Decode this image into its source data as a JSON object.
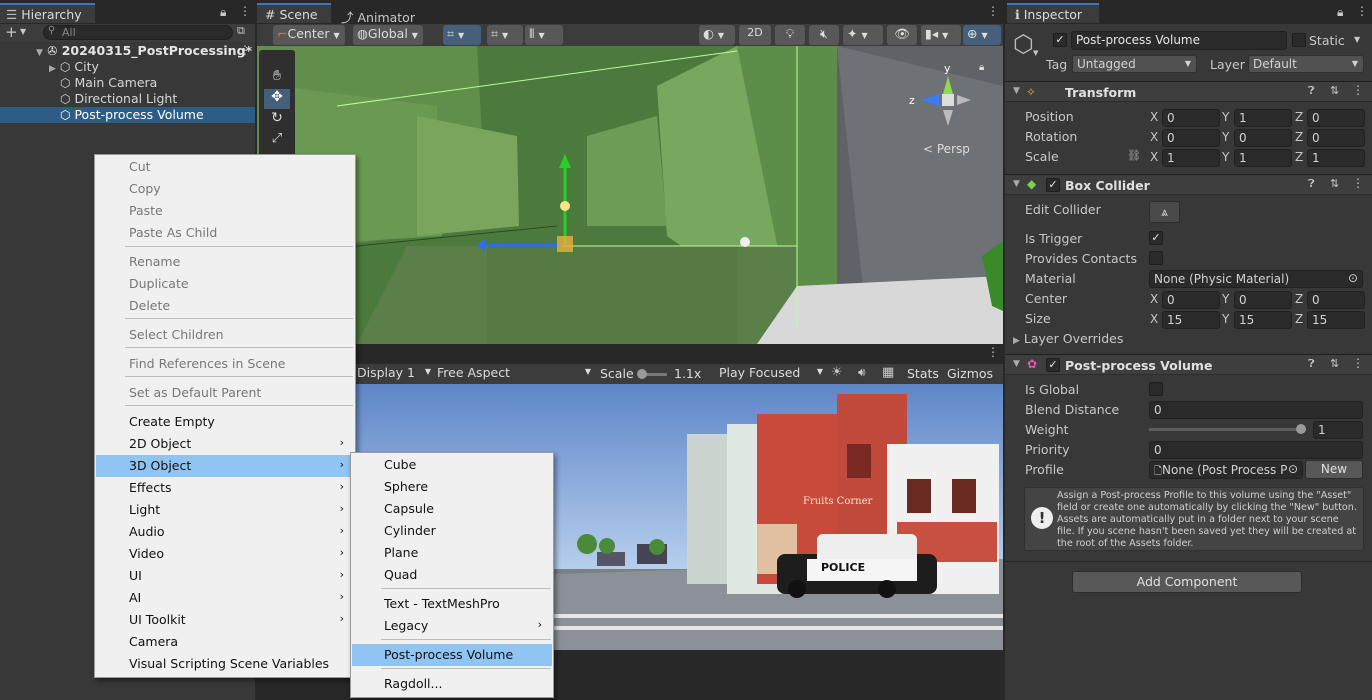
{
  "hierarchy": {
    "tab": "Hierarchy",
    "search_placeholder": "All",
    "scene": "20240315_PostProcessing*",
    "items": [
      "City",
      "Main Camera",
      "Directional Light",
      "Post-process Volume"
    ]
  },
  "scene_view": {
    "tabs": [
      "Scene",
      "Animator"
    ],
    "pivot": "Center",
    "space": "Global",
    "mode_2d": "2D",
    "persp": "Persp",
    "axis_y": "y",
    "axis_z": "z"
  },
  "game_view": {
    "display": "Display 1",
    "aspect": "Free Aspect",
    "scale_label": "Scale",
    "scale_value": "1.1x",
    "play_mode": "Play Focused",
    "stats": "Stats",
    "gizmos": "Gizmos",
    "scale_fraction": 0.1,
    "sign_fruits": "Fruits Corner",
    "car_text": "POLICE"
  },
  "context_menu": {
    "items": [
      {
        "label": "Cut",
        "enabled": false
      },
      {
        "label": "Copy",
        "enabled": false
      },
      {
        "label": "Paste",
        "enabled": false
      },
      {
        "label": "Paste As Child",
        "enabled": false
      },
      {
        "label": "Rename",
        "enabled": false
      },
      {
        "label": "Duplicate",
        "enabled": false
      },
      {
        "label": "Delete",
        "enabled": false
      },
      {
        "label": "Select Children",
        "enabled": false
      },
      {
        "label": "Find References in Scene",
        "enabled": false
      },
      {
        "label": "Set as Default Parent",
        "enabled": false
      },
      {
        "label": "Create Empty",
        "enabled": true
      },
      {
        "label": "2D Object",
        "enabled": true
      },
      {
        "label": "3D Object",
        "enabled": true
      },
      {
        "label": "Effects",
        "enabled": true
      },
      {
        "label": "Light",
        "enabled": true
      },
      {
        "label": "Audio",
        "enabled": true
      },
      {
        "label": "Video",
        "enabled": true
      },
      {
        "label": "UI",
        "enabled": true
      },
      {
        "label": "AI",
        "enabled": true
      },
      {
        "label": "UI Toolkit",
        "enabled": true
      },
      {
        "label": "Camera",
        "enabled": true
      },
      {
        "label": "Visual Scripting Scene Variables",
        "enabled": true
      }
    ],
    "submenu_3d": [
      "Cube",
      "Sphere",
      "Capsule",
      "Cylinder",
      "Plane",
      "Quad",
      "Text - TextMeshPro",
      "Legacy",
      "Post-process Volume",
      "Ragdoll..."
    ]
  },
  "inspector": {
    "tab": "Inspector",
    "object_name": "Post-process Volume",
    "static_label": "Static",
    "tag_label": "Tag",
    "tag_value": "Untagged",
    "layer_label": "Layer",
    "layer_value": "Default",
    "transform": {
      "title": "Transform",
      "position_label": "Position",
      "rotation_label": "Rotation",
      "scale_label": "Scale",
      "position": [
        "0",
        "1",
        "0"
      ],
      "rotation": [
        "0",
        "0",
        "0"
      ],
      "scale": [
        "1",
        "1",
        "1"
      ]
    },
    "box_collider": {
      "title": "Box Collider",
      "edit_collider": "Edit Collider",
      "is_trigger": "Is Trigger",
      "provides_contacts": "Provides Contacts",
      "material_label": "Material",
      "material_value": "None (Physic Material)",
      "center_label": "Center",
      "center": [
        "0",
        "0",
        "0"
      ],
      "size_label": "Size",
      "size": [
        "15",
        "15",
        "15"
      ],
      "layer_overrides": "Layer Overrides"
    },
    "ppv": {
      "title": "Post-process Volume",
      "is_global": "Is Global",
      "blend_label": "Blend Distance",
      "blend_value": "0",
      "weight_label": "Weight",
      "weight_value": "1",
      "priority_label": "Priority",
      "priority_value": "0",
      "profile_label": "Profile",
      "profile_value": "None (Post Process P",
      "new_button": "New",
      "help": "Assign a Post-process Profile to this volume using the \"Asset\" field or create one automatically by clicking the \"New\" button. Assets are automatically put in a folder next to your scene file. If you scene hasn't been saved yet they will be created at the root of the Assets folder."
    },
    "add_component": "Add Component",
    "axis": [
      "X",
      "Y",
      "Z"
    ]
  }
}
